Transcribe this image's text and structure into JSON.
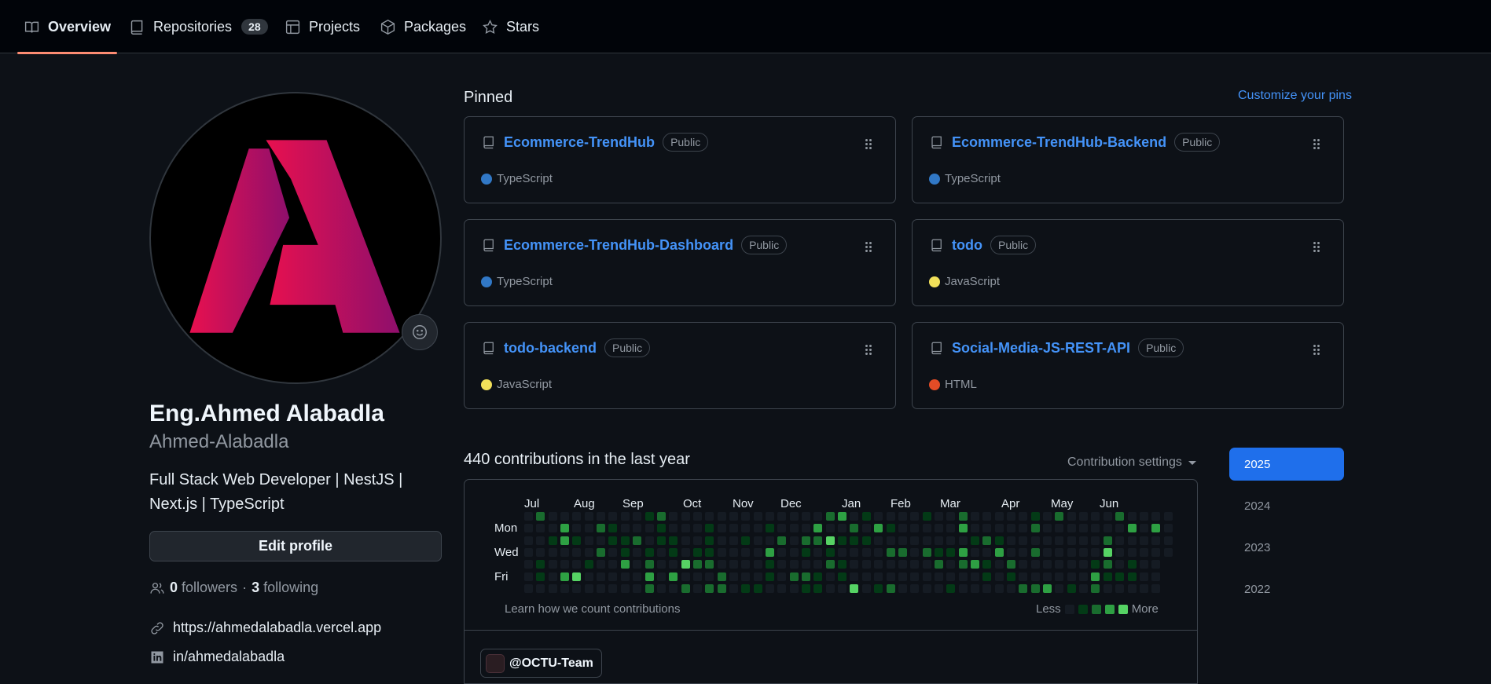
{
  "nav": {
    "tabs": [
      {
        "label": "Overview",
        "icon": "book-icon"
      },
      {
        "label": "Repositories",
        "icon": "repo-icon",
        "count": "28"
      },
      {
        "label": "Projects",
        "icon": "table-icon"
      },
      {
        "label": "Packages",
        "icon": "package-icon"
      },
      {
        "label": "Stars",
        "icon": "star-icon"
      }
    ],
    "active_tab": "Overview"
  },
  "profile": {
    "full_name": "Eng.Ahmed Alabadla",
    "login": "Ahmed-Alabadla",
    "bio": "Full Stack Web Developer | NestJS | Next.js | TypeScript",
    "edit_label": "Edit profile",
    "followers_count": "0",
    "followers_label": "followers",
    "separator": "·",
    "following_count": "3",
    "following_label": "following",
    "website": "https://ahmedalabadla.vercel.app",
    "linkedin": "in/ahmedalabadla"
  },
  "pinned": {
    "title": "Pinned",
    "customize_label": "Customize your pins",
    "repos": [
      {
        "name": "Ecommerce-TrendHub",
        "visibility": "Public",
        "language": "TypeScript",
        "language_color": "#3178c6"
      },
      {
        "name": "Ecommerce-TrendHub-Backend",
        "visibility": "Public",
        "language": "TypeScript",
        "language_color": "#3178c6"
      },
      {
        "name": "Ecommerce-TrendHub-Dashboard",
        "visibility": "Public",
        "language": "TypeScript",
        "language_color": "#3178c6"
      },
      {
        "name": "todo",
        "visibility": "Public",
        "language": "JavaScript",
        "language_color": "#f1e05a"
      },
      {
        "name": "todo-backend",
        "visibility": "Public",
        "language": "JavaScript",
        "language_color": "#f1e05a"
      },
      {
        "name": "Social-Media-JS-REST-API",
        "visibility": "Public",
        "language": "HTML",
        "language_color": "#e34c26"
      }
    ]
  },
  "contributions": {
    "title": "440 contributions in the last year",
    "settings_label": "Contribution settings",
    "months": [
      "Jul",
      "Aug",
      "Sep",
      "Oct",
      "Nov",
      "Dec",
      "Jan",
      "Feb",
      "Mar",
      "Apr",
      "May",
      "Jun"
    ],
    "weekdays": [
      "Mon",
      "Wed",
      "Fri"
    ],
    "learn_label": "Learn how we count contributions",
    "less_label": "Less",
    "more_label": "More",
    "level_colors": [
      "#151b23",
      "#033a16",
      "#196c2e",
      "#2ea043",
      "#56d364"
    ],
    "org_label": "@OCTU-Team"
  },
  "years": {
    "items": [
      "2025",
      "2024",
      "2023",
      "2022"
    ],
    "selected": "2025"
  },
  "colors": {
    "link": "#4493f8",
    "active_underline": "#fd8c73",
    "year_selected": "#1f6feb"
  }
}
